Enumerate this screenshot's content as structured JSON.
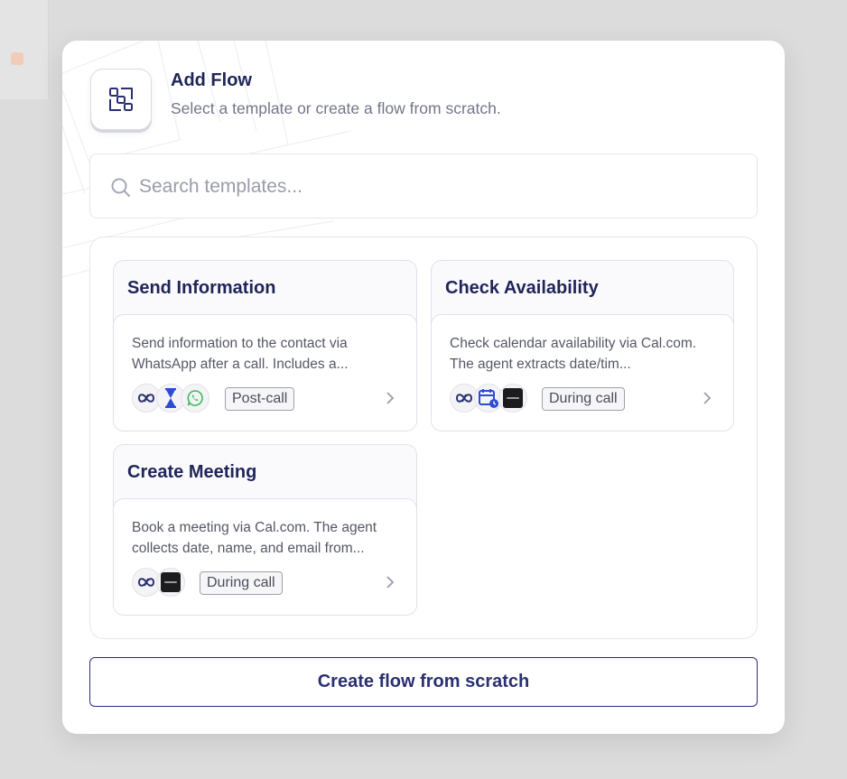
{
  "background": {
    "partial_text": ""
  },
  "modal": {
    "title": "Add Flow",
    "subtitle": "Select a template or create a flow from scratch.",
    "header_icon": "flow-diagram-icon"
  },
  "search": {
    "placeholder": "Search templates...",
    "value": ""
  },
  "templates": [
    {
      "title": "Send Information",
      "description": "Send information to the contact via WhatsApp after a call. Includes a...",
      "icons": [
        "infinity-icon",
        "hourglass-icon",
        "whatsapp-icon"
      ],
      "tag": "Post-call"
    },
    {
      "title": "Check Availability",
      "description": "Check calendar availability via Cal.com. The agent extracts date/tim...",
      "icons": [
        "infinity-icon",
        "calendar-clock-icon",
        "calcom-icon"
      ],
      "tag": "During call"
    },
    {
      "title": "Create Meeting",
      "description": "Book a meeting via Cal.com. The agent collects date, name, and email from...",
      "icons": [
        "infinity-icon",
        "calcom-icon"
      ],
      "tag": "During call"
    }
  ],
  "cta": {
    "label": "Create flow from scratch"
  },
  "colors": {
    "primary": "#2a3070",
    "title": "#1f2557",
    "icon_blue": "#2d4bd3",
    "whatsapp": "#3fb85c",
    "backdrop": "#dcdcdd"
  }
}
